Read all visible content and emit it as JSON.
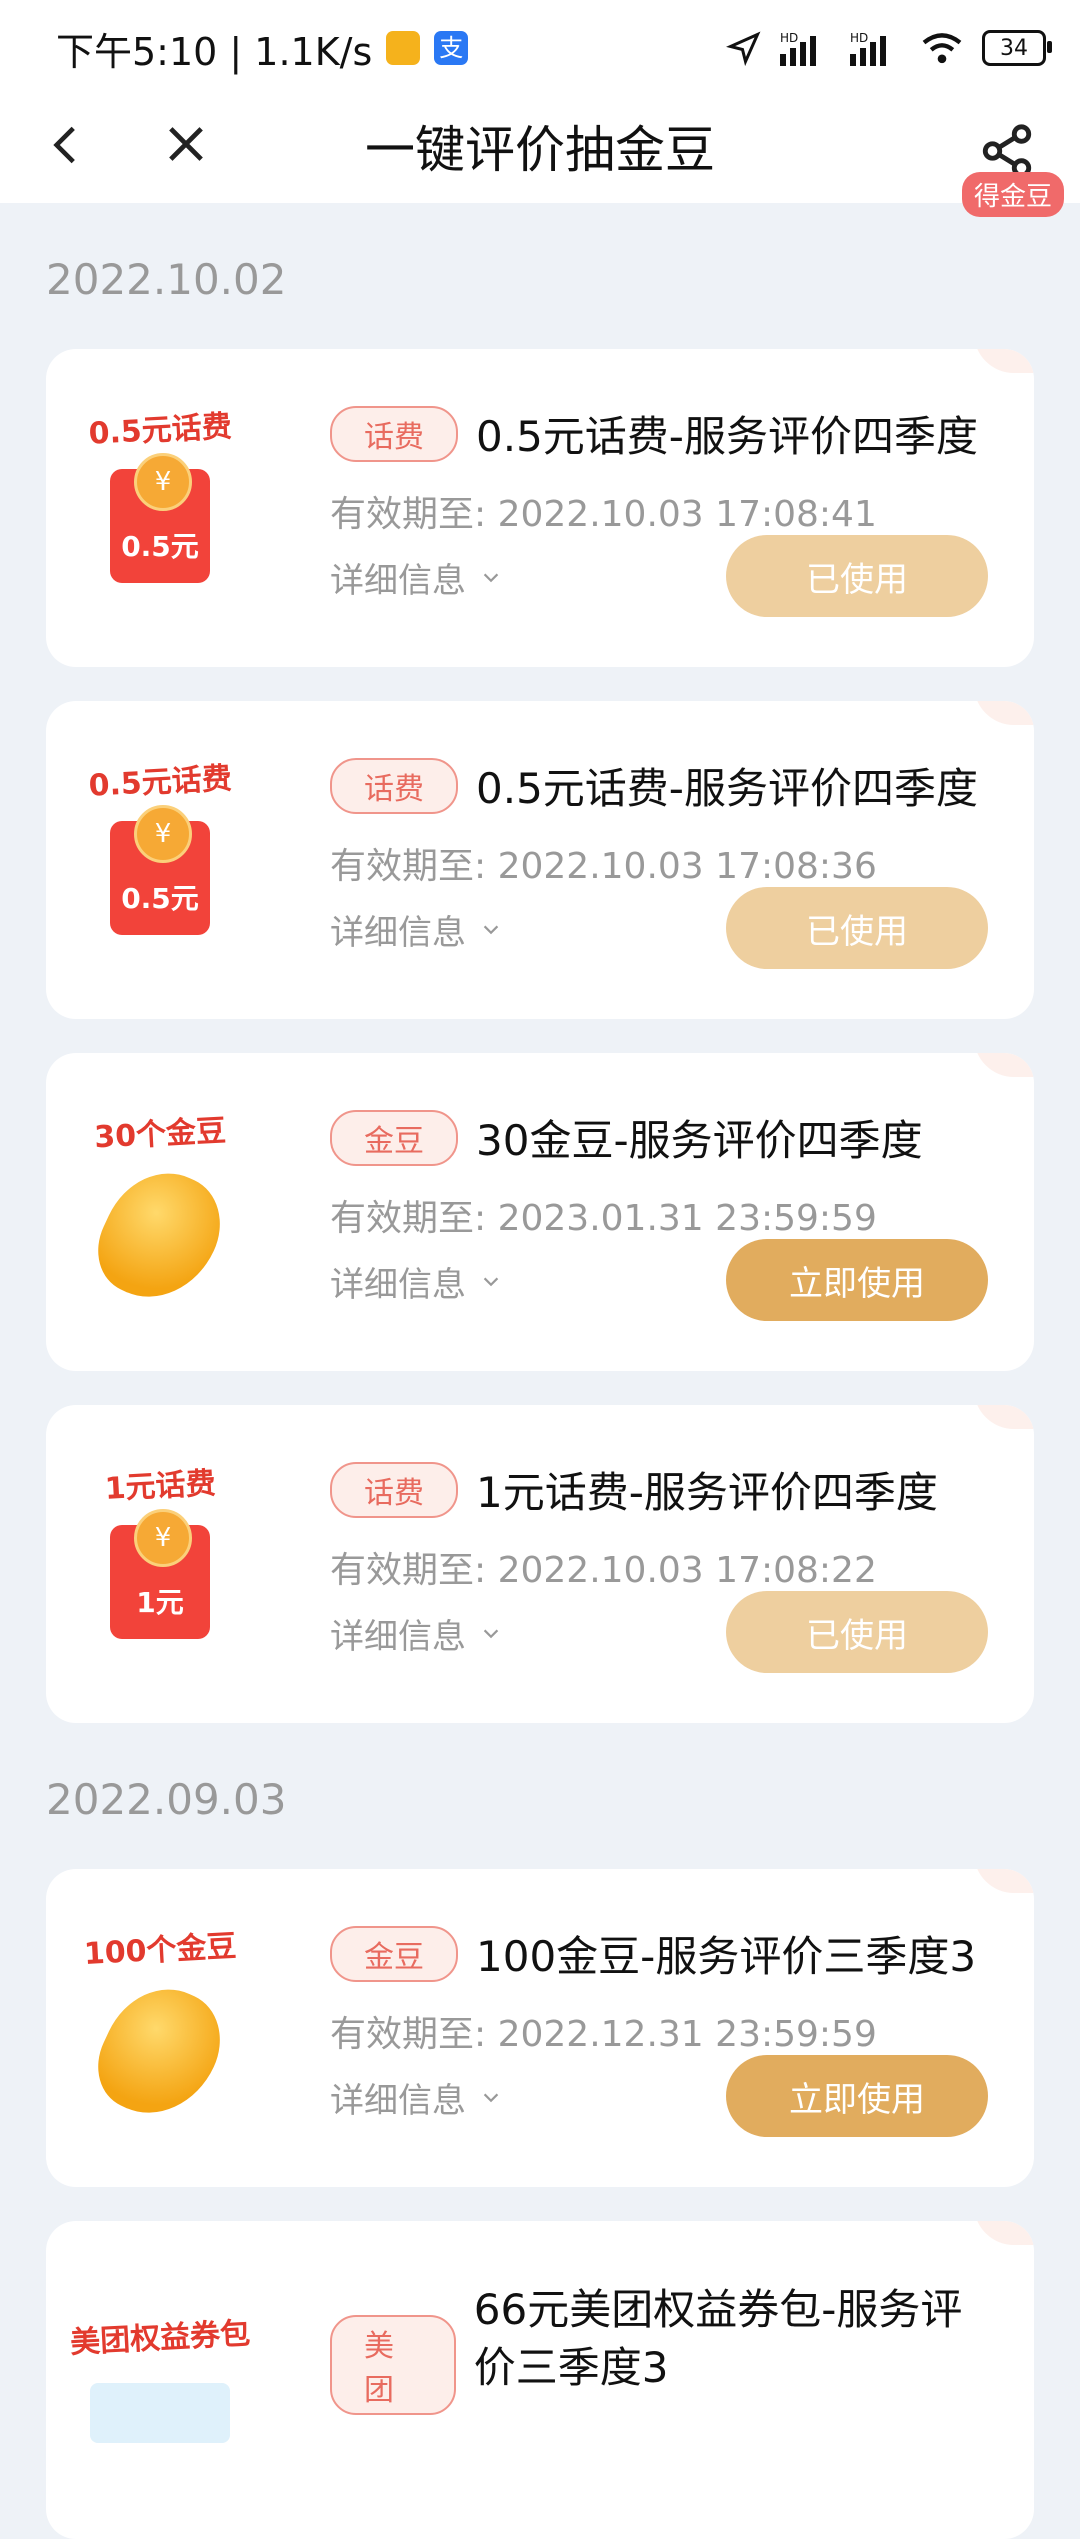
{
  "status": {
    "time_speed": "下午5:10 | 1.1K/s",
    "battery": "34",
    "app_icon_colors": [
      "#f5b21c",
      "#2a78f4"
    ]
  },
  "header": {
    "title": "一键评价抽金豆",
    "badge": "得金豆"
  },
  "groups": [
    {
      "date": "2022.10.02",
      "cards": [
        {
          "thumb_label": "0.5元话费",
          "thumb_type": "redpack",
          "thumb_amount": "0.5元",
          "tag": "话费",
          "name": "0.5元话费-服务评价四季度",
          "expiry_label": "有效期至:",
          "expiry": "2022.10.03 17:08:41",
          "detail": "详细信息",
          "button": "已使用",
          "button_state": "used"
        },
        {
          "thumb_label": "0.5元话费",
          "thumb_type": "redpack",
          "thumb_amount": "0.5元",
          "tag": "话费",
          "name": "0.5元话费-服务评价四季度",
          "expiry_label": "有效期至:",
          "expiry": "2022.10.03 17:08:36",
          "detail": "详细信息",
          "button": "已使用",
          "button_state": "used"
        },
        {
          "thumb_label": "30个金豆",
          "thumb_type": "bean",
          "thumb_amount": "",
          "tag": "金豆",
          "name": "30金豆-服务评价四季度",
          "expiry_label": "有效期至:",
          "expiry": "2023.01.31 23:59:59",
          "detail": "详细信息",
          "button": "立即使用",
          "button_state": "active"
        },
        {
          "thumb_label": "1元话费",
          "thumb_type": "redpack",
          "thumb_amount": "1元",
          "tag": "话费",
          "name": "1元话费-服务评价四季度",
          "expiry_label": "有效期至:",
          "expiry": "2022.10.03 17:08:22",
          "detail": "详细信息",
          "button": "已使用",
          "button_state": "used"
        }
      ]
    },
    {
      "date": "2022.09.03",
      "cards": [
        {
          "thumb_label": "100个金豆",
          "thumb_type": "bean",
          "thumb_amount": "",
          "tag": "金豆",
          "name": "100金豆-服务评价三季度3",
          "expiry_label": "有效期至:",
          "expiry": "2022.12.31 23:59:59",
          "detail": "详细信息",
          "button": "立即使用",
          "button_state": "active"
        },
        {
          "thumb_label": "美团权益券包",
          "thumb_type": "pack",
          "thumb_amount": "",
          "tag": "美团",
          "name": "66元美团权益券包-服务评价三季度3",
          "expiry_label": "",
          "expiry": "",
          "detail": "",
          "button": "",
          "button_state": "none"
        }
      ]
    }
  ]
}
